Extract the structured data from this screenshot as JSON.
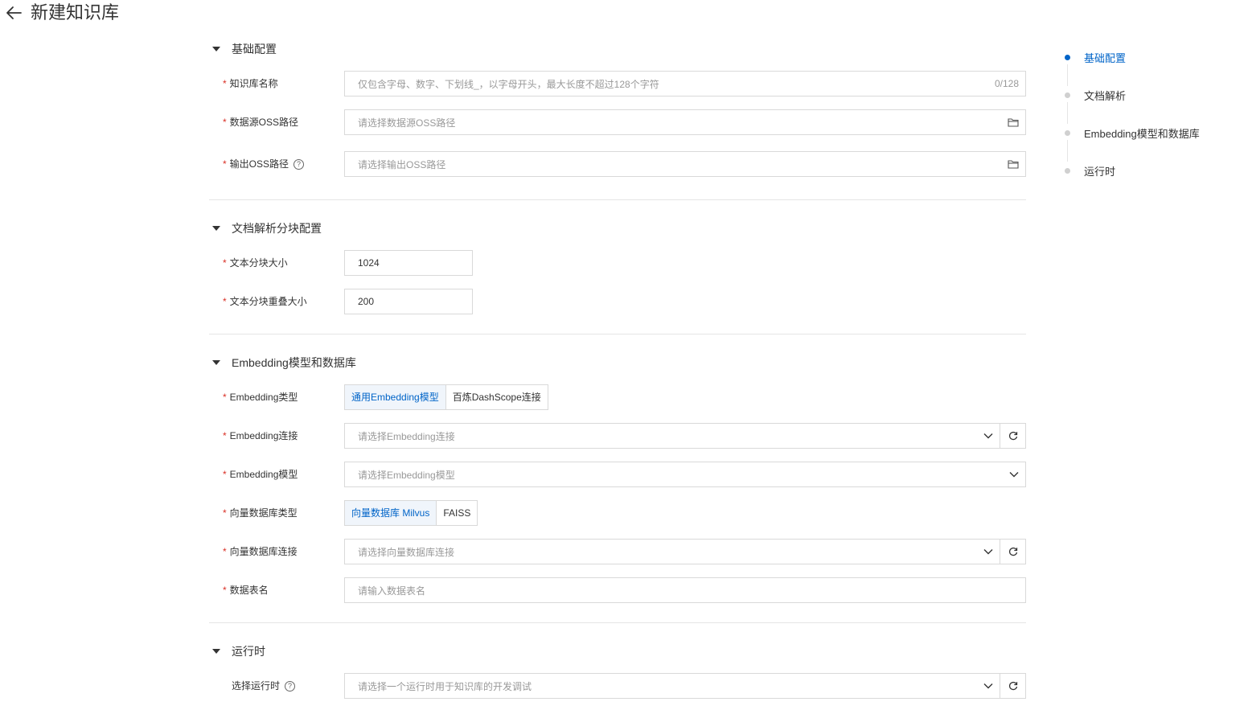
{
  "header": {
    "title": "新建知识库"
  },
  "sections": {
    "basic": {
      "title": "基础配置",
      "name_label": "知识库名称",
      "name_placeholder": "仅包含字母、数字、下划线_，以字母开头，最大长度不超过128个字符",
      "name_counter": "0/128",
      "source_label": "数据源OSS路径",
      "source_placeholder": "请选择数据源OSS路径",
      "output_label": "输出OSS路径",
      "output_placeholder": "请选择输出OSS路径"
    },
    "parse": {
      "title": "文档解析分块配置",
      "chunk_label": "文本分块大小",
      "chunk_value": "1024",
      "overlap_label": "文本分块重叠大小",
      "overlap_value": "200"
    },
    "embedding": {
      "title": "Embedding模型和数据库",
      "type_label": "Embedding类型",
      "type_options": [
        "通用Embedding模型",
        "百炼DashScope连接"
      ],
      "conn_label": "Embedding连接",
      "conn_placeholder": "请选择Embedding连接",
      "model_label": "Embedding模型",
      "model_placeholder": "请选择Embedding模型",
      "vdb_type_label": "向量数据库类型",
      "vdb_type_options": [
        "向量数据库 Milvus",
        "FAISS"
      ],
      "vdb_conn_label": "向量数据库连接",
      "vdb_conn_placeholder": "请选择向量数据库连接",
      "table_label": "数据表名",
      "table_placeholder": "请输入数据表名"
    },
    "runtime": {
      "title": "运行时",
      "runtime_label": "选择运行时",
      "runtime_placeholder": "请选择一个运行时用于知识库的开发调试"
    }
  },
  "required_mark": "*",
  "help_glyph": "?",
  "anchor": {
    "items": [
      "基础配置",
      "文档解析",
      "Embedding模型和数据库",
      "运行时"
    ],
    "active_index": 0
  },
  "colors": {
    "accent": "#0064c8",
    "required": "#d93026",
    "border": "#d9d9d9"
  }
}
